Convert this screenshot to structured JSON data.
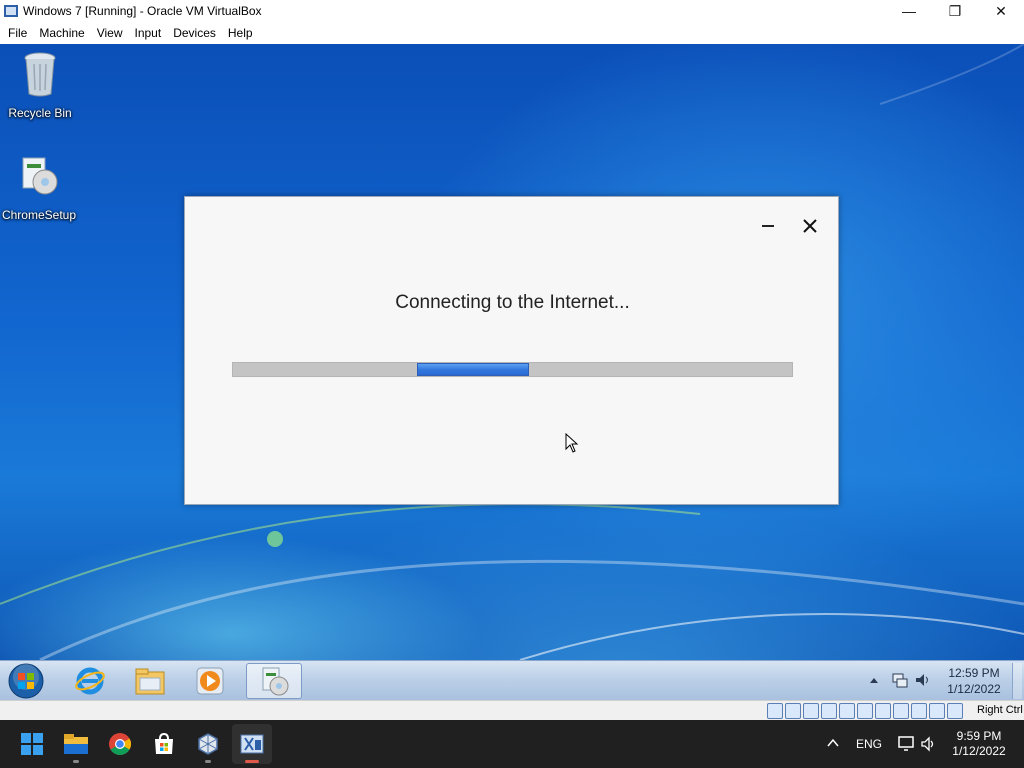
{
  "host_window": {
    "title": "Windows 7 [Running] - Oracle VM VirtualBox",
    "controls": {
      "minimize": "—",
      "maximize": "❐",
      "close": "✕"
    }
  },
  "menu": {
    "items": [
      "File",
      "Machine",
      "View",
      "Input",
      "Devices",
      "Help"
    ]
  },
  "desktop": {
    "icons": [
      {
        "label": "Recycle Bin",
        "icon": "recycle-bin-icon"
      },
      {
        "label": "ChromeSetup",
        "icon": "installer-icon"
      }
    ]
  },
  "dialog": {
    "message": "Connecting to the Internet...",
    "progress_fraction_start": 0.33,
    "progress_fraction_width": 0.2
  },
  "guest_taskbar": {
    "pinned": [
      "internet-explorer-icon",
      "windows-explorer-icon",
      "media-player-icon",
      "chrome-setup-icon"
    ],
    "clock_time": "12:59 PM",
    "clock_date": "1/12/2022"
  },
  "vbox_status": {
    "host_key": "Right Ctrl"
  },
  "host_taskbar": {
    "apps": [
      "start-icon",
      "file-explorer-icon",
      "chrome-icon",
      "store-icon",
      "virtualbox-icon",
      "vm-window-icon"
    ],
    "language": "ENG",
    "clock_time": "9:59 PM",
    "clock_date": "1/12/2022"
  }
}
